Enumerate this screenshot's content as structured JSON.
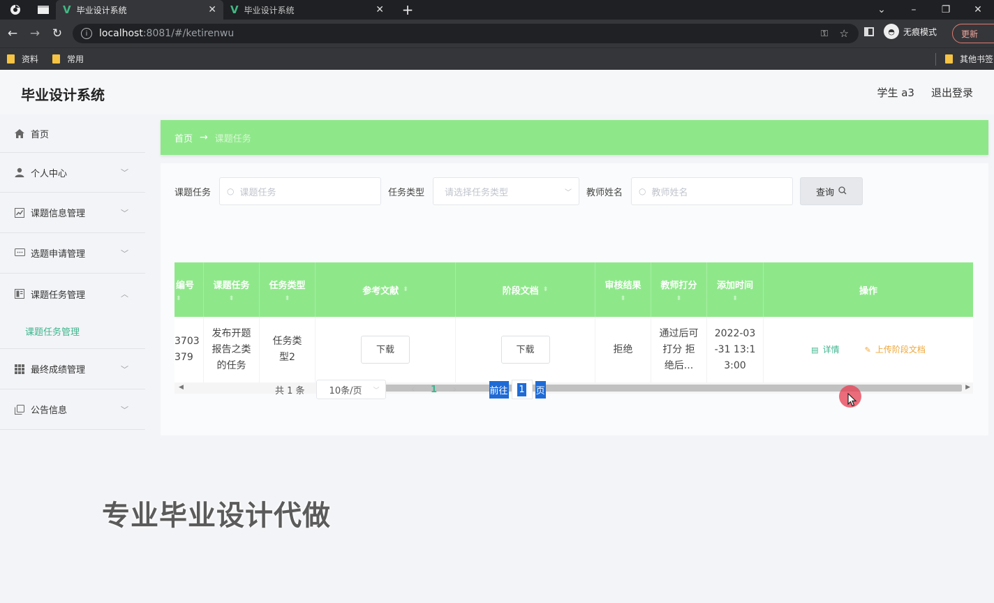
{
  "browser": {
    "tabs": [
      {
        "title": "毕业设计系统",
        "active": true
      },
      {
        "title": "毕业设计系统",
        "active": false
      }
    ],
    "url_host": "localhost",
    "url_rest": ":8081/#/ketirenwu",
    "incognito_label": "无痕模式",
    "update_label": "更新",
    "bookmarks": [
      "资料",
      "常用"
    ],
    "other_bookmarks": "其他书签"
  },
  "header": {
    "brand": "毕业设计系统",
    "user": "学生 a3",
    "logout": "退出登录"
  },
  "sidebar": {
    "items": [
      {
        "label": "首页",
        "icon": "home-icon"
      },
      {
        "label": "个人中心",
        "icon": "user-icon"
      },
      {
        "label": "课题信息管理",
        "icon": "chart-icon"
      },
      {
        "label": "选题申请管理",
        "icon": "message-icon"
      },
      {
        "label": "课题任务管理",
        "icon": "document-icon"
      },
      {
        "label": "最终成绩管理",
        "icon": "grid-icon"
      },
      {
        "label": "公告信息",
        "icon": "copy-icon"
      }
    ],
    "subitem": "课题任务管理"
  },
  "breadcrumb": {
    "home": "首页",
    "arrow": "→",
    "current": "课题任务"
  },
  "search": {
    "task_label": "课题任务",
    "task_placeholder": "课题任务",
    "type_label": "任务类型",
    "type_placeholder": "请选择任务类型",
    "teacher_label": "教师姓名",
    "teacher_placeholder": "教师姓名",
    "query_label": "查询"
  },
  "table": {
    "columns": [
      "编号",
      "课题任务",
      "任务类型",
      "参考文献",
      "阶段文档",
      "审核结果",
      "教师打分",
      "添加时间",
      "操作"
    ],
    "row": {
      "id": "3703\n379",
      "task": "发布开题报告之类的任务",
      "type": "任务类型2",
      "ref_download": "下载",
      "doc_download": "下载",
      "review": "拒绝",
      "score": "通过后可打分 拒绝后...",
      "time": "2022-03-31 13:13:00",
      "detail": "详情",
      "upload": "上传阶段文档"
    }
  },
  "pagination": {
    "total": "共 1 条",
    "page_size": "10条/页",
    "current": "1",
    "goto_prefix": "前往",
    "goto_value": "1",
    "goto_suffix": "页"
  },
  "watermark": "专业毕业设计代做"
}
